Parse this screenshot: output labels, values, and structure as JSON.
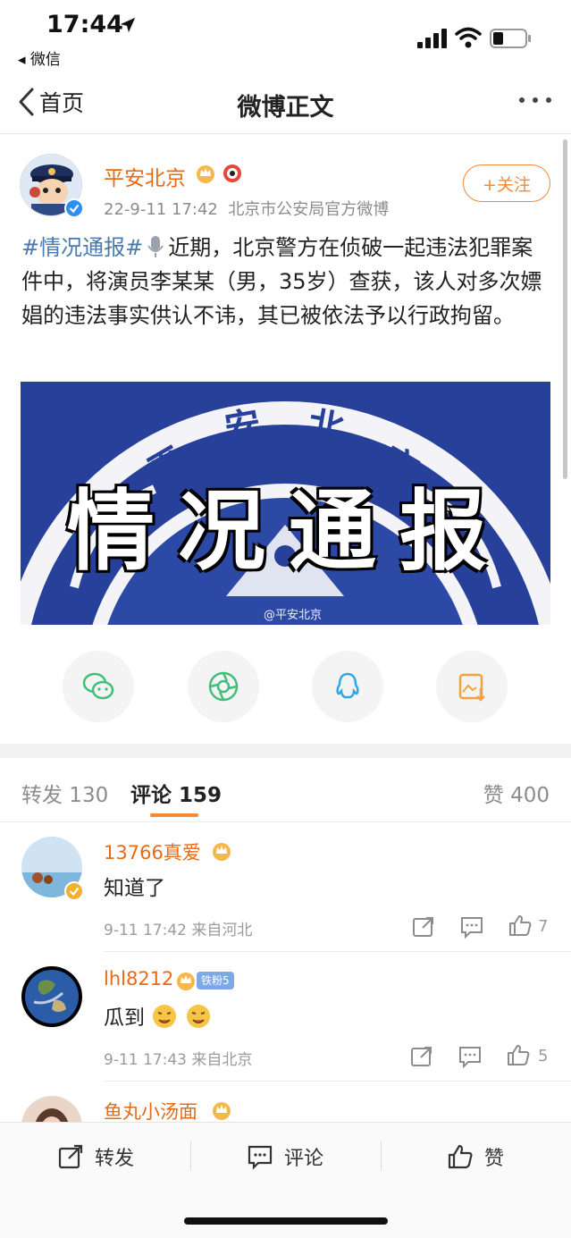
{
  "status_bar": {
    "time": "17:44",
    "back_app": "◂ 微信"
  },
  "nav": {
    "back_label": "首页",
    "title": "微博正文"
  },
  "post": {
    "author": "平安北京",
    "date": "22-9-11 17:42",
    "source": "北京市公安局官方微博",
    "follow_label": "+关注",
    "hashtag": "#情况通报#",
    "text": "近期，北京警方在侦破一起违法犯罪案件中，将演员李某某（男，35岁）查获，该人对多次嫖娼的违法事实供认不讳，其已被依法予以行政拘留。",
    "image": {
      "arc_text": [
        "平",
        "安",
        "北",
        "京"
      ],
      "title": "情况通报",
      "watermark": "@平安北京"
    }
  },
  "share": {
    "items": [
      {
        "icon": "wechat-icon",
        "color": "#3fbf7a"
      },
      {
        "icon": "moments-icon",
        "color": "#3fbf7a"
      },
      {
        "icon": "qq-icon",
        "color": "#2fa6e8"
      },
      {
        "icon": "save-image-icon",
        "color": "#f0a340"
      }
    ]
  },
  "tabs": {
    "repost": "转发 130",
    "comment": "评论 159",
    "like": "赞 400"
  },
  "comments": [
    {
      "name": "13766真爱",
      "text": "知道了",
      "meta": "9-11 17:42  来自河北",
      "likes": "7"
    },
    {
      "name": "lhl8212",
      "fan_badge": "铁粉5",
      "text": "瓜到",
      "meta": "9-11 17:43  来自北京",
      "likes": "5"
    },
    {
      "name": "鱼丸小汤面"
    }
  ],
  "bottom_bar": {
    "repost": "转发",
    "comment": "评论",
    "like": "赞"
  },
  "colors": {
    "accent": "#f28a36",
    "username": "#e86a12",
    "hashtag": "#4a79ad"
  }
}
